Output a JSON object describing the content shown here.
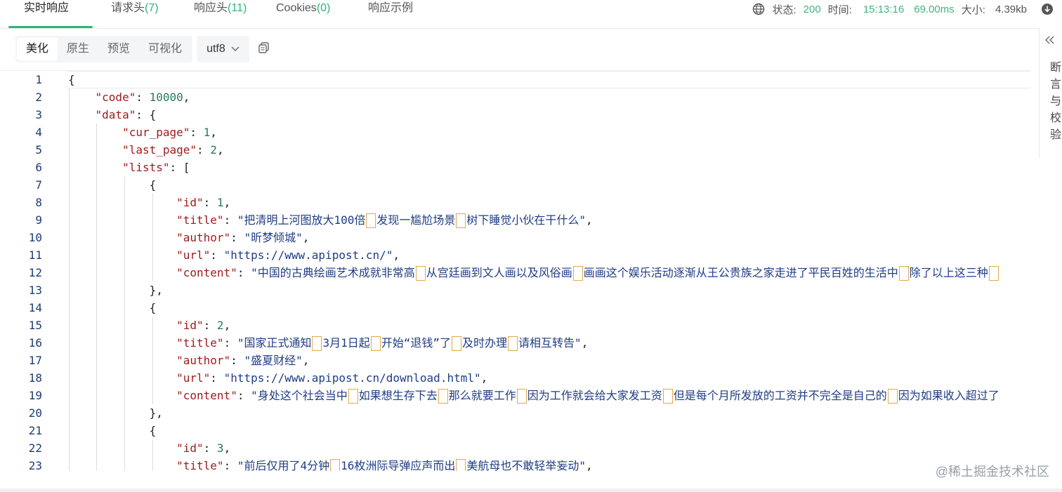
{
  "tabs": [
    {
      "label": "实时响应",
      "count": ""
    },
    {
      "label": "请求头",
      "count": "(7)"
    },
    {
      "label": "响应头",
      "count": "(11)"
    },
    {
      "label": "Cookies",
      "count": "(0)"
    },
    {
      "label": "响应示例",
      "count": ""
    }
  ],
  "status": {
    "status_label": "状态:",
    "status_value": "200",
    "time_label": "时间:",
    "time_value": "15:13:16",
    "duration_value": "69.00ms",
    "size_label": "大小:",
    "size_value": "4.39kb"
  },
  "view_modes": [
    "美化",
    "原生",
    "预览",
    "可视化"
  ],
  "encoding": "utf8",
  "right_panel": {
    "chars": [
      "断",
      "言",
      "与",
      "校",
      "验"
    ]
  },
  "colors": {
    "accent": "#2fb574",
    "key": "#9e1a1a",
    "string": "#1f3c85",
    "number": "#2a7a5a"
  },
  "code_lines": [
    "{",
    "    \"code\": 10000,",
    "    \"data\": {",
    "        \"cur_page\": 1,",
    "        \"last_page\": 2,",
    "        \"lists\": [",
    "            {",
    "                \"id\": 1,",
    "                \"title\": \"把清明上河图放大100倍，发现一尴尬场景，树下睡觉小伙在干什么\",",
    "                \"author\": \"昕梦倾城\",",
    "                \"url\": \"https://www.apipost.cn/\",",
    "                \"content\": \"中国的古典绘画艺术成就非常高，从宫廷画到文人画以及风俗画，画画这个娱乐活动逐渐从王公贵族之家走进了平民百姓的生活中，除了以上这三种，",
    "            },",
    "            {",
    "                \"id\": 2,",
    "                \"title\": \"国家正式通知，3月1日起，开始“退钱”了！及时办理，请相互转告\",",
    "                \"author\": \"盛夏财经\",",
    "                \"url\": \"https://www.apipost.cn/download.html\",",
    "                \"content\": \"身处这个社会当中，如果想生存下去，那么就要工作，因为工作就会给大家发工资，但是每个月所发放的工资并不完全是自己的，因为如果收入超过了",
    "            },",
    "            {",
    "                \"id\": 3,",
    "                \"title\": \"前后仅用了4分钟，16枚洲际导弹应声而出，美航母也不敢轻举妄动\","
  ],
  "watermark": "@稀土掘金技术社区"
}
